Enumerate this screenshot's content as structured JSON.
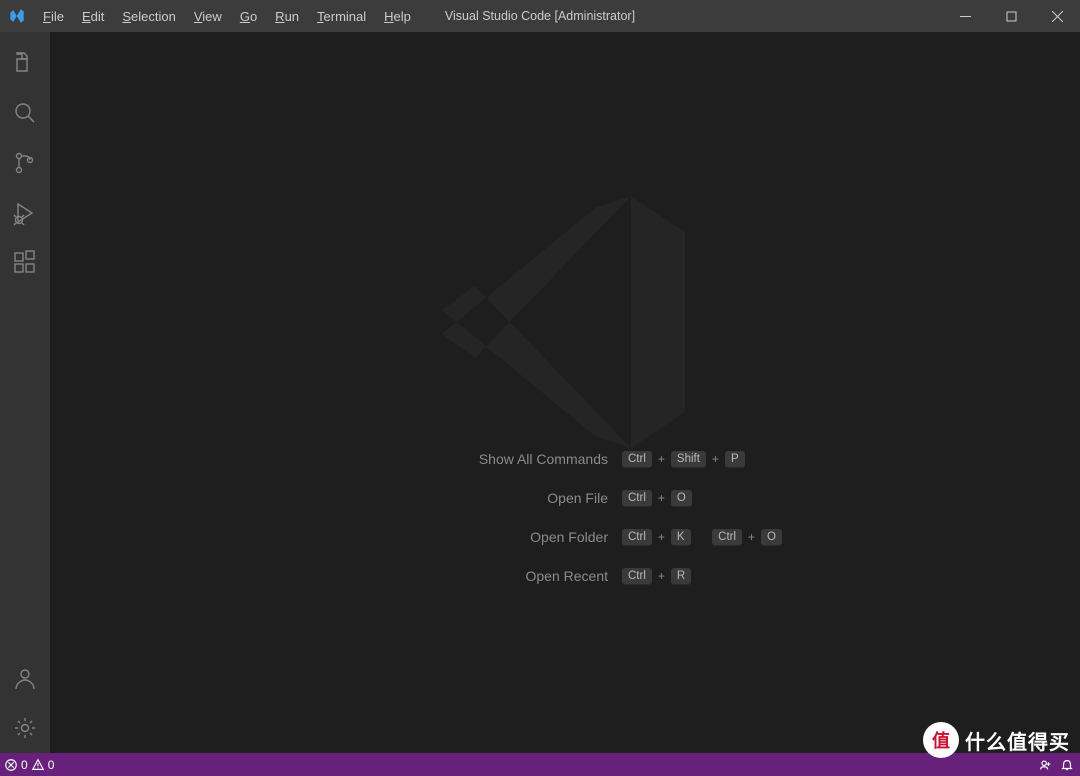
{
  "title": "Visual Studio Code [Administrator]",
  "menu": [
    "File",
    "Edit",
    "Selection",
    "View",
    "Go",
    "Run",
    "Terminal",
    "Help"
  ],
  "activity": {
    "top": [
      "explorer",
      "search",
      "source-control",
      "run-debug",
      "extensions"
    ],
    "bottom": [
      "accounts",
      "settings"
    ]
  },
  "shortcuts": [
    {
      "label": "Show All Commands",
      "keys": [
        "Ctrl",
        "Shift",
        "P"
      ]
    },
    {
      "label": "Open File",
      "keys": [
        "Ctrl",
        "O"
      ]
    },
    {
      "label": "Open Folder",
      "keys": [
        "Ctrl",
        "K",
        "Ctrl",
        "O"
      ],
      "split_after": 2
    },
    {
      "label": "Open Recent",
      "keys": [
        "Ctrl",
        "R"
      ]
    }
  ],
  "status": {
    "errors": "0",
    "warnings": "0"
  },
  "badge": {
    "char": "值",
    "text": "什么值得买"
  }
}
